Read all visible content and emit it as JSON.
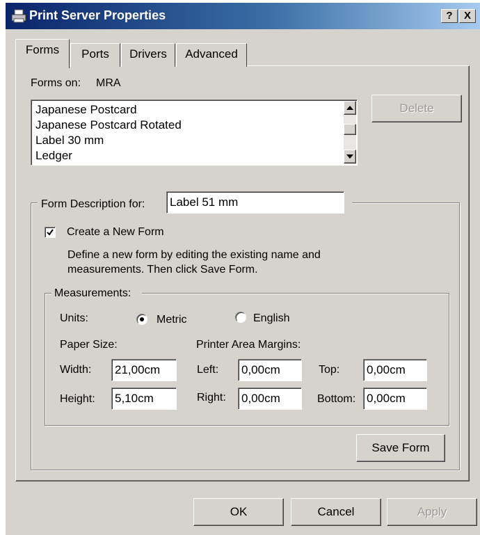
{
  "window": {
    "title": "Print Server Properties",
    "help_button": "?",
    "close_button": "X"
  },
  "tabs": [
    {
      "label": "Forms",
      "active": true
    },
    {
      "label": "Ports",
      "active": false
    },
    {
      "label": "Drivers",
      "active": false
    },
    {
      "label": "Advanced",
      "active": false
    }
  ],
  "forms_panel": {
    "forms_on_label": "Forms on:",
    "server_name": "MRA",
    "forms_list": [
      "Japanese Postcard",
      "Japanese Postcard Rotated",
      "Label 30 mm",
      "Ledger"
    ],
    "delete_button": "Delete"
  },
  "form_description": {
    "label": "Form Description for:",
    "value": "Label 51 mm",
    "create_new_label": "Create a New Form",
    "create_new_checked": true,
    "help_text_line1": "Define a new form by editing the existing name and",
    "help_text_line2": "measurements.  Then click Save Form."
  },
  "measurements": {
    "title": "Measurements:",
    "units_label": "Units:",
    "units_options": [
      "Metric",
      "English"
    ],
    "units_selected": "Metric",
    "paper_size_label": "Paper Size:",
    "margins_label": "Printer Area Margins:",
    "width_label": "Width:",
    "width_value": "21,00cm",
    "height_label": "Height:",
    "height_value": "5,10cm",
    "left_label": "Left:",
    "left_value": "0,00cm",
    "right_label": "Right:",
    "right_value": "0,00cm",
    "top_label": "Top:",
    "top_value": "0,00cm",
    "bottom_label": "Bottom:",
    "bottom_value": "0,00cm"
  },
  "save_form_button": "Save Form",
  "dialog_buttons": {
    "ok": "OK",
    "cancel": "Cancel",
    "apply": "Apply"
  }
}
